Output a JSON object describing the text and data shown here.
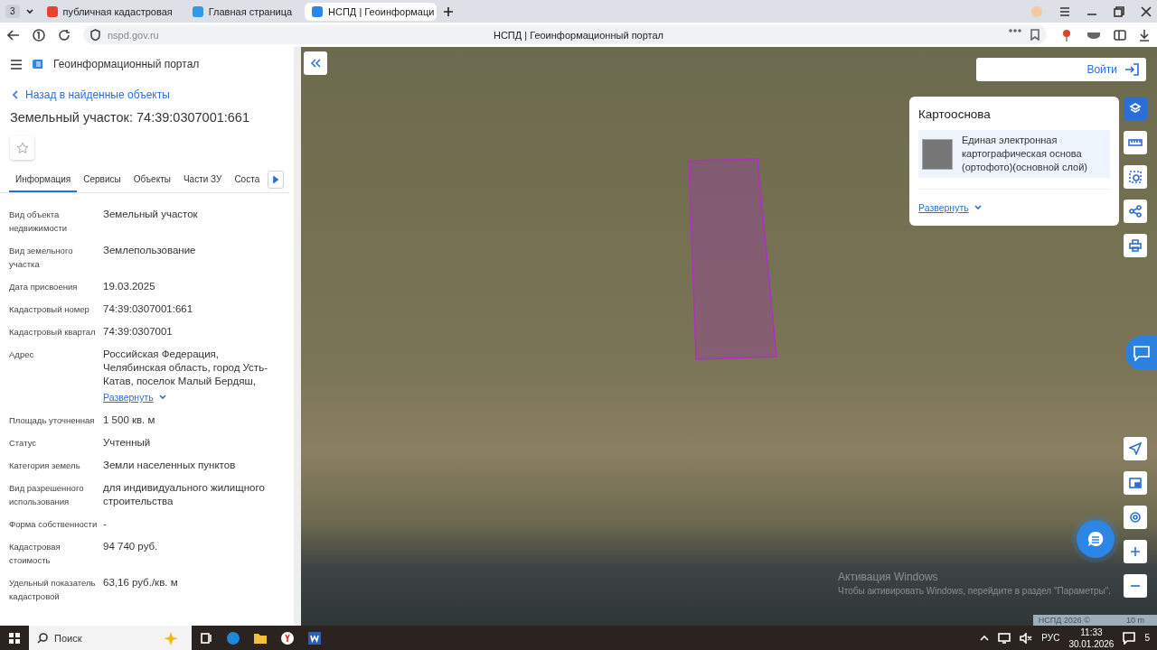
{
  "browser": {
    "tab_count": "3",
    "tabs": [
      {
        "title": "публичная кадастровая",
        "selected": false
      },
      {
        "title": "Главная страница",
        "selected": false
      },
      {
        "title": "НСПД | Геоинформаци",
        "selected": true
      }
    ],
    "url": "nspd.gov.ru",
    "page_title": "НСПД | Геоинформационный портал"
  },
  "sidebar": {
    "portal_title": "Геоинформационный портал",
    "back_link": "Назад в найденные объекты",
    "heading": "Земельный участок: 74:39:0307001:661",
    "favorite": false,
    "tabs": [
      {
        "label": "Информация",
        "selected": true
      },
      {
        "label": "Сервисы",
        "selected": false
      },
      {
        "label": "Объекты",
        "selected": false
      },
      {
        "label": "Части ЗУ",
        "selected": false
      },
      {
        "label": "Соста",
        "selected": false
      }
    ],
    "fields": [
      {
        "label": "Вид объекта недвижимости",
        "value": "Земельный участок"
      },
      {
        "label": "Вид земельного участка",
        "value": "Землепользование"
      },
      {
        "label": "Дата присвоения",
        "value": "19.03.2025"
      },
      {
        "label": "Кадастровый номер",
        "value": "74:39:0307001:661"
      },
      {
        "label": "Кадастровый квартал",
        "value": "74:39:0307001"
      },
      {
        "label": "Адрес",
        "value": "Российская Федерация, Челябинская область, город Усть-Катав, поселок Малый Бердяш,",
        "link": "Развернуть"
      },
      {
        "label": "Площадь уточненная",
        "value": "1 500 кв. м"
      },
      {
        "label": "Статус",
        "value": "Учтенный"
      },
      {
        "label": "Категория земель",
        "value": "Земли населенных пунктов"
      },
      {
        "label": "Вид разрешенного использования",
        "value": "для индивидуального жилищного строительства"
      },
      {
        "label": "Форма собственности",
        "value": "-"
      },
      {
        "label": "Кадастровая стоимость",
        "value": "94 740 руб."
      },
      {
        "label": "Удельный показатель кадастровой",
        "value": "63,16 руб./кв. м"
      }
    ]
  },
  "map": {
    "login_button": "Войти",
    "basemap": {
      "title": "Картооснова",
      "layer": "Единая электронная картографическая основа (ортофото)(основной слой)",
      "expand_link": "Развернуть"
    },
    "copyright": "НСПД 2026 ©",
    "scale": "10 m",
    "os_notice": [
      "Активация Windows",
      "Чтобы активировать Windows, перейдите в раздел \"Параметры\"."
    ]
  },
  "taskbar": {
    "search_placeholder": "Поиск",
    "language": "РУС",
    "time": "11:33",
    "date": "30.01.2026",
    "notifications": "5"
  }
}
